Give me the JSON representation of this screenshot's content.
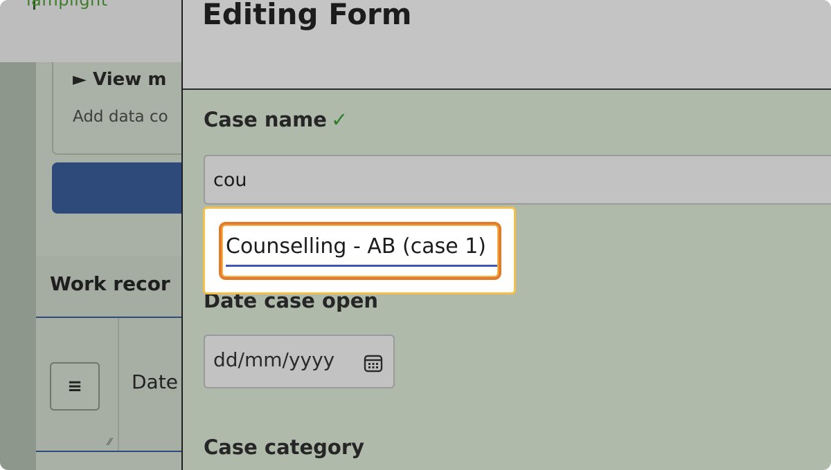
{
  "background_page": {
    "brand": "lamplight",
    "view_toggle": "► View m",
    "view_description": "Add data co",
    "work_records_title": "Work recor",
    "menu_button_glyph": "≡",
    "date_column_header": "Date",
    "brand_color": "#3f7d2c",
    "primary_button_color": "#2d4a7b"
  },
  "modal": {
    "title": "Editing Form",
    "case_name": {
      "label": "Case name",
      "valid_mark": "✓",
      "value": "cou"
    },
    "suggestion": {
      "label": "Counselling - AB (case 1)",
      "highlight_color": "#e07c2c"
    },
    "date_case_open": {
      "label": "Date case open",
      "placeholder": "dd/mm/yyyy",
      "icon": "calendar-icon"
    },
    "case_category": {
      "label": "Case category"
    }
  }
}
